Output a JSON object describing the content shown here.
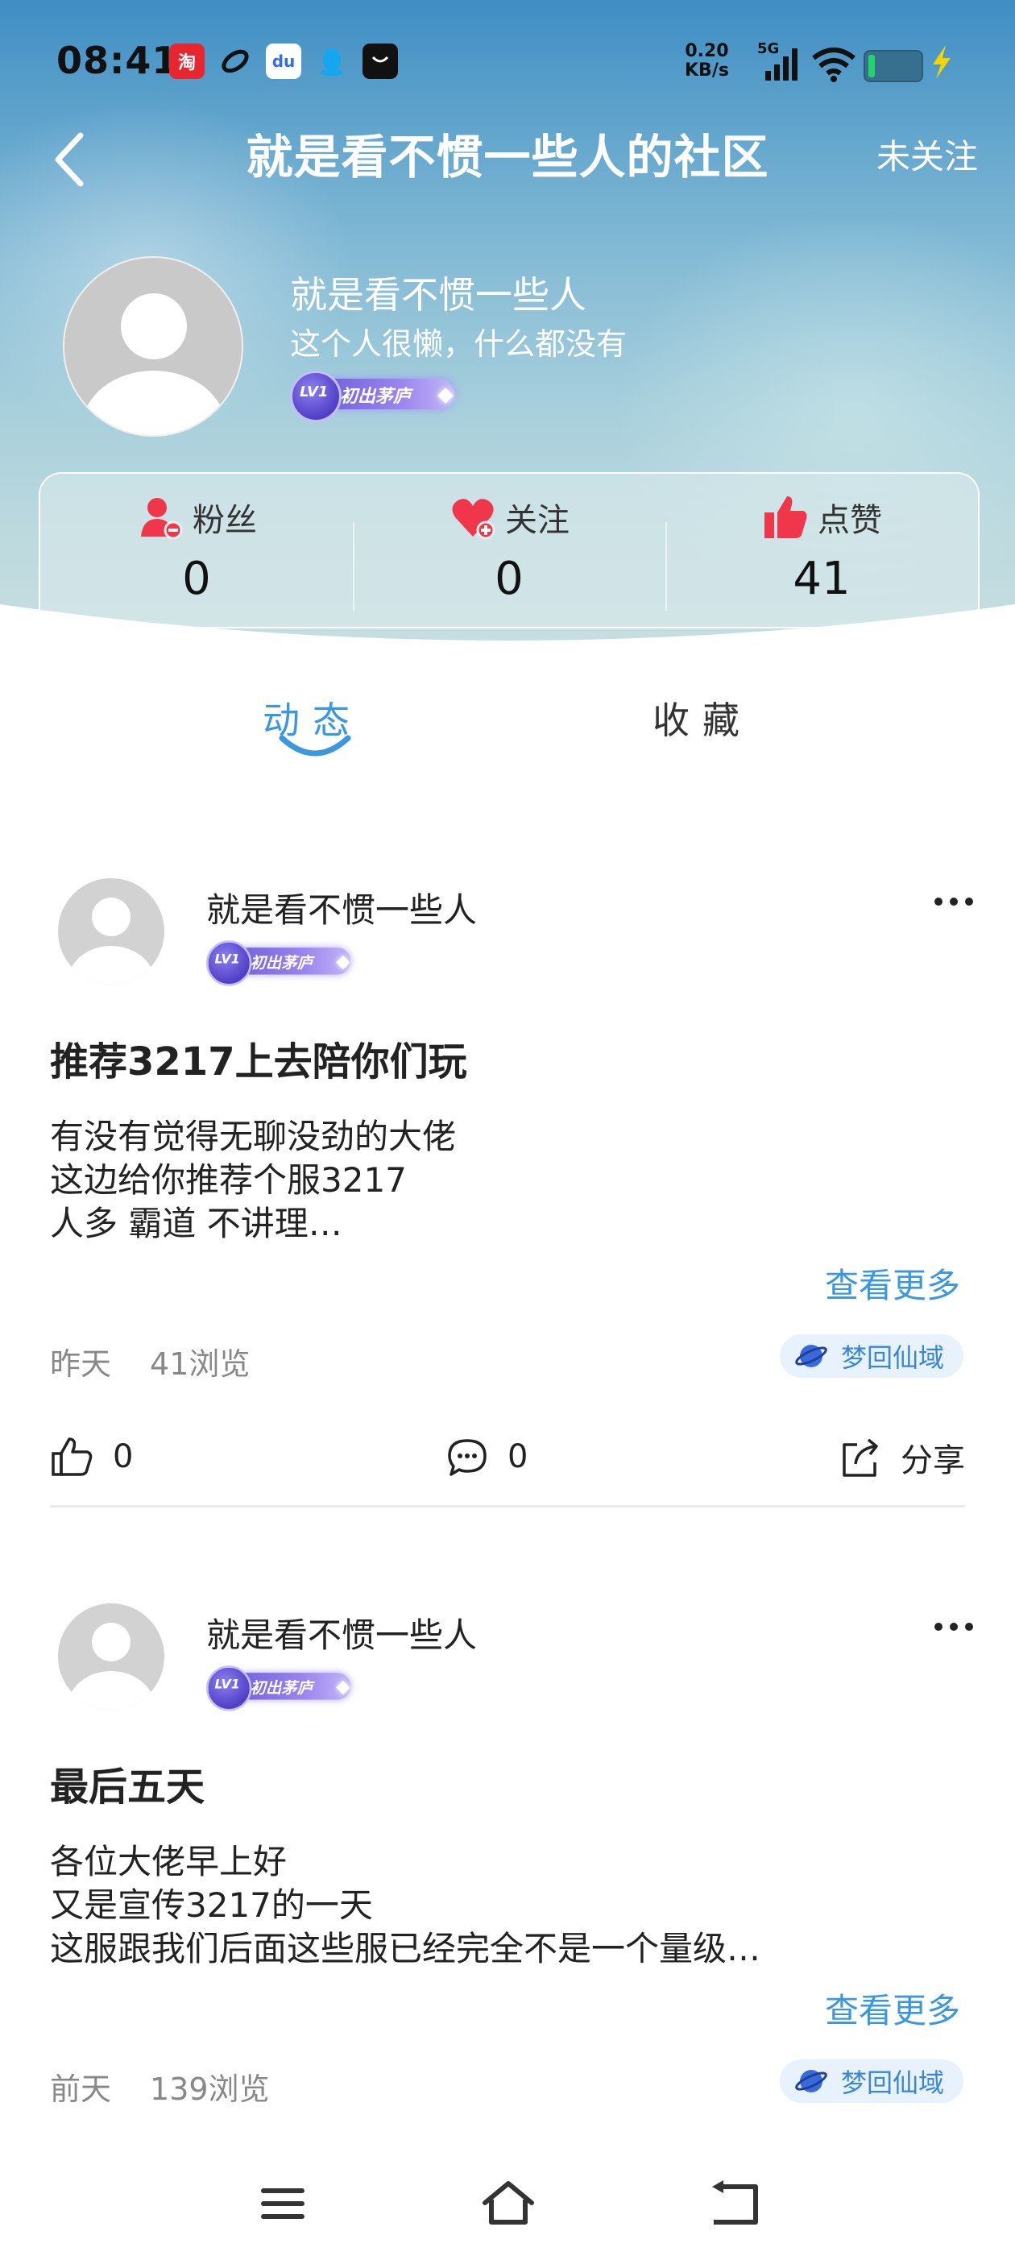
{
  "status_bar": {
    "time": "08:41",
    "app_icons": [
      "taobao-icon",
      "browser-icon",
      "baidu-icon",
      "qq-icon",
      "message-icon"
    ],
    "net_rate_value": "0.20",
    "net_rate_unit": "KB/s",
    "signal_label": "5G",
    "colors": {
      "taobao": "#e8262f",
      "baidu": "#2f6df3",
      "qq": "#14a7f0"
    }
  },
  "header": {
    "title": "就是看不惯一些人的社区",
    "follow_label": "未关注"
  },
  "profile": {
    "username": "就是看不惯一些人",
    "bio": "这个人很懒，什么都没有",
    "level": "LV1",
    "badge_text": "初出茅庐"
  },
  "stats": [
    {
      "icon": "fans-icon",
      "label": "粉丝",
      "value": "0"
    },
    {
      "icon": "follow-heart-icon",
      "label": "关注",
      "value": "0"
    },
    {
      "icon": "thumbs-up-icon",
      "label": "点赞",
      "value": "41"
    }
  ],
  "tabs": [
    {
      "label": "动态",
      "active": true
    },
    {
      "label": "收藏",
      "active": false
    }
  ],
  "posts": [
    {
      "author": "就是看不惯一些人",
      "level": "LV1",
      "badge_text": "初出茅庐",
      "title": "推荐3217上去陪你们玩",
      "body_lines": [
        "有没有觉得无聊没劲的大佬",
        "这边给你推荐个服3217",
        "人多 霸道 不讲理…"
      ],
      "see_more": "查看更多",
      "time": "昨天",
      "views": "41浏览",
      "community": "梦回仙域",
      "likes": "0",
      "comments": "0",
      "share_label": "分享"
    },
    {
      "author": "就是看不惯一些人",
      "level": "LV1",
      "badge_text": "初出茅庐",
      "title": "最后五天",
      "body_lines": [
        "各位大佬早上好",
        "又是宣传3217的一天",
        "这服跟我们后面这些服已经完全不是一个量级…"
      ],
      "see_more": "查看更多",
      "time": "前天",
      "views": "139浏览",
      "community": "梦回仙域"
    }
  ],
  "bottom_nav": [
    "menu-icon",
    "home-icon",
    "back-nav-icon"
  ],
  "colors": {
    "accent": "#3a97e0",
    "like_red": "#f0364b"
  }
}
